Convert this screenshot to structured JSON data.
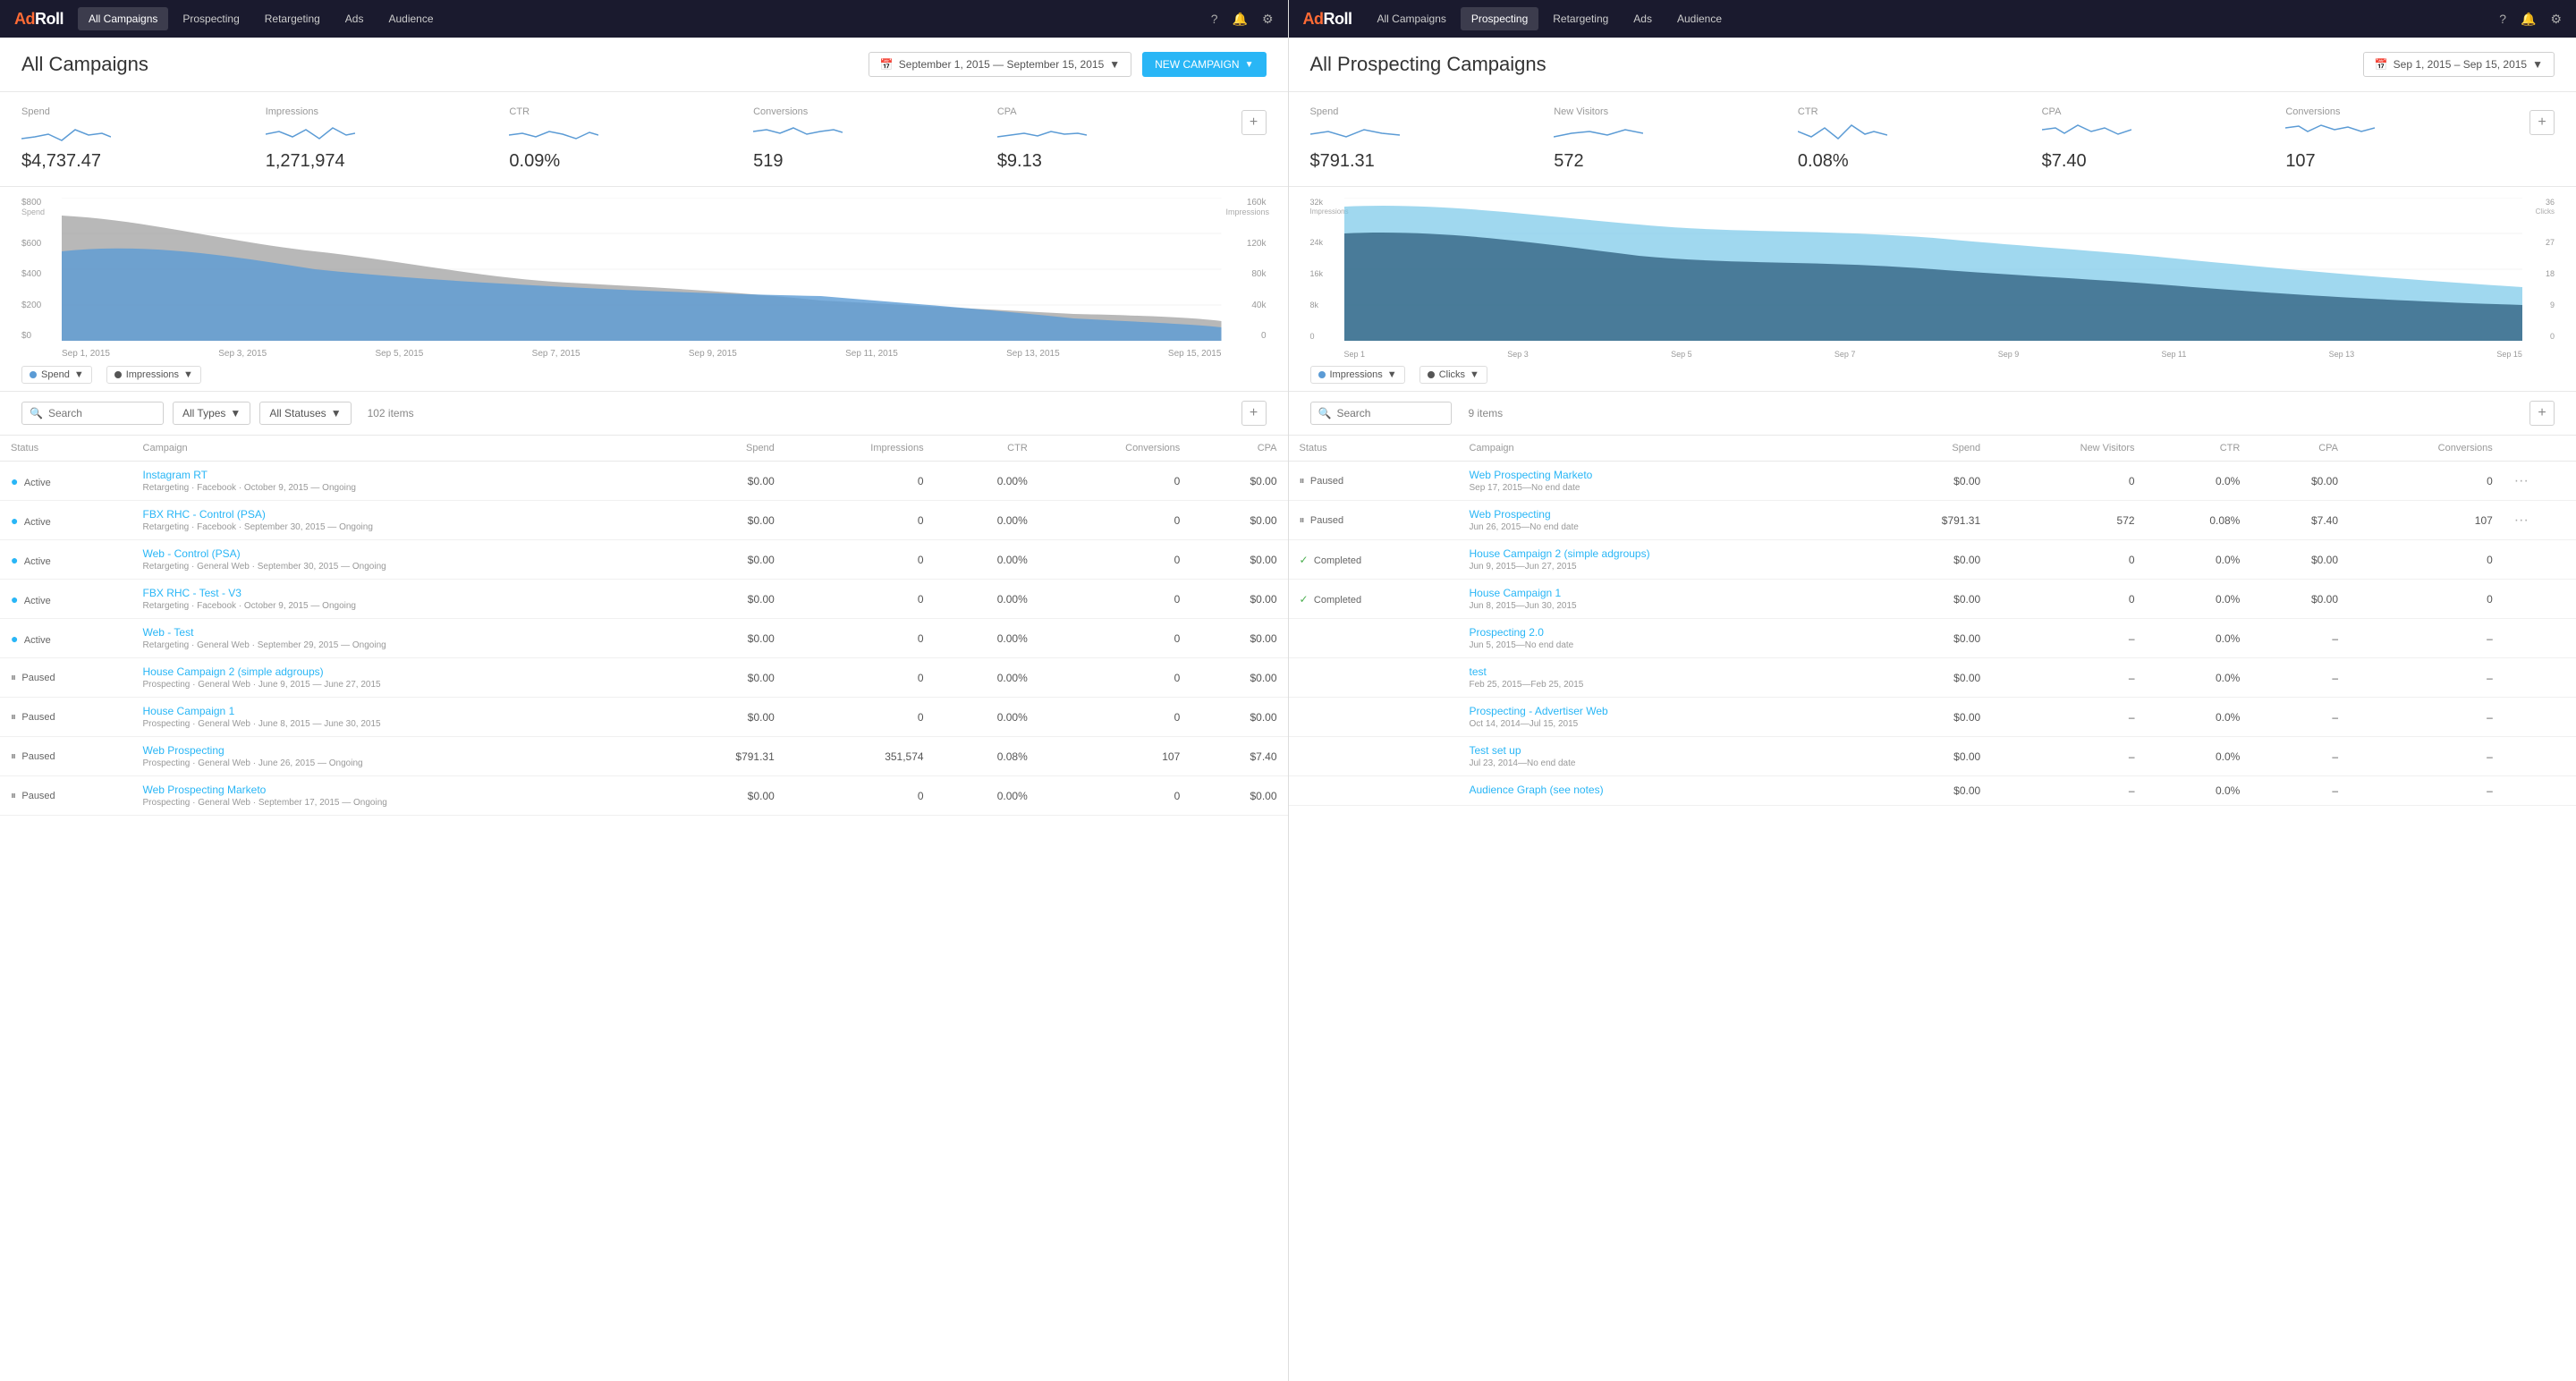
{
  "left_panel": {
    "nav": {
      "logo": "AdRoll",
      "items": [
        "All Campaigns",
        "Prospecting",
        "Retargeting",
        "Ads",
        "Audience"
      ],
      "active": "All Campaigns"
    },
    "title": "All Campaigns",
    "date_range": "September 1, 2015 — September 15, 2015",
    "new_campaign_label": "NEW CAMPAIGN",
    "metrics": [
      {
        "label": "Spend",
        "value": "$4,737.47"
      },
      {
        "label": "Impressions",
        "value": "1,271,974"
      },
      {
        "label": "CTR",
        "value": "0.09%"
      },
      {
        "label": "Conversions",
        "value": "519"
      },
      {
        "label": "CPA",
        "value": "$9.13"
      }
    ],
    "chart": {
      "y_left_label": "Spend",
      "y_right_label": "Impressions",
      "y_left": [
        "$800",
        "$600",
        "$400",
        "$200",
        "$0"
      ],
      "y_right": [
        "160k",
        "120k",
        "80k",
        "40k",
        "0"
      ],
      "x_axis": [
        "Sep 1, 2015",
        "Sep 3, 2015",
        "Sep 5, 2015",
        "Sep 7, 2015",
        "Sep 9, 2015",
        "Sep 11, 2015",
        "Sep 13, 2015",
        "Sep 15, 2015"
      ],
      "legend": [
        {
          "label": "Spend",
          "color": "#5b9bd5"
        },
        {
          "label": "Impressions",
          "color": "#555"
        }
      ]
    },
    "filter": {
      "search_placeholder": "Search",
      "type_label": "All Types",
      "status_label": "All Statuses",
      "items_count": "102 items"
    },
    "table": {
      "columns": [
        "Status",
        "Campaign",
        "Spend",
        "Impressions",
        "CTR",
        "Conversions",
        "CPA"
      ],
      "rows": [
        {
          "status": "Active",
          "status_type": "active",
          "name": "Instagram RT",
          "sub": "Retargeting · Facebook · October 9, 2015 — Ongoing",
          "spend": "$0.00",
          "impressions": "0",
          "ctr": "0.00%",
          "conversions": "0",
          "cpa": "$0.00"
        },
        {
          "status": "Active",
          "status_type": "active",
          "name": "FBX RHC - Control (PSA)",
          "sub": "Retargeting · Facebook · September 30, 2015 — Ongoing",
          "spend": "$0.00",
          "impressions": "0",
          "ctr": "0.00%",
          "conversions": "0",
          "cpa": "$0.00"
        },
        {
          "status": "Active",
          "status_type": "active",
          "name": "Web - Control (PSA)",
          "sub": "Retargeting · General Web · September 30, 2015 — Ongoing",
          "spend": "$0.00",
          "impressions": "0",
          "ctr": "0.00%",
          "conversions": "0",
          "cpa": "$0.00"
        },
        {
          "status": "Active",
          "status_type": "active",
          "name": "FBX RHC - Test - V3",
          "sub": "Retargeting · Facebook · October 9, 2015 — Ongoing",
          "spend": "$0.00",
          "impressions": "0",
          "ctr": "0.00%",
          "conversions": "0",
          "cpa": "$0.00"
        },
        {
          "status": "Active",
          "status_type": "active",
          "name": "Web - Test",
          "sub": "Retargeting · General Web · September 29, 2015 — Ongoing",
          "spend": "$0.00",
          "impressions": "0",
          "ctr": "0.00%",
          "conversions": "0",
          "cpa": "$0.00"
        },
        {
          "status": "Paused",
          "status_type": "paused",
          "name": "House Campaign 2 (simple adgroups)",
          "sub": "Prospecting · General Web · June 9, 2015 — June 27, 2015",
          "spend": "$0.00",
          "impressions": "0",
          "ctr": "0.00%",
          "conversions": "0",
          "cpa": "$0.00"
        },
        {
          "status": "Paused",
          "status_type": "paused",
          "name": "House Campaign 1",
          "sub": "Prospecting · General Web · June 8, 2015 — June 30, 2015",
          "spend": "$0.00",
          "impressions": "0",
          "ctr": "0.00%",
          "conversions": "0",
          "cpa": "$0.00"
        },
        {
          "status": "Paused",
          "status_type": "paused",
          "name": "Web Prospecting",
          "sub": "Prospecting · General Web · June 26, 2015 — Ongoing",
          "spend": "$791.31",
          "impressions": "351,574",
          "ctr": "0.08%",
          "conversions": "107",
          "cpa": "$7.40"
        },
        {
          "status": "Paused",
          "status_type": "paused",
          "name": "Web Prospecting Marketo",
          "sub": "Prospecting · General Web · September 17, 2015 — Ongoing",
          "spend": "$0.00",
          "impressions": "0",
          "ctr": "0.00%",
          "conversions": "0",
          "cpa": "$0.00"
        }
      ]
    }
  },
  "right_panel": {
    "nav": {
      "logo": "AdRoll",
      "items": [
        "All Campaigns",
        "Prospecting",
        "Retargeting",
        "Ads",
        "Audience"
      ],
      "active": "Prospecting"
    },
    "title": "All Prospecting Campaigns",
    "date_range": "Sep 1, 2015 – Sep 15, 2015",
    "metrics": [
      {
        "label": "Spend",
        "value": "$791.31"
      },
      {
        "label": "New Visitors",
        "value": "572"
      },
      {
        "label": "CTR",
        "value": "0.08%"
      },
      {
        "label": "CPA",
        "value": "$7.40"
      },
      {
        "label": "Conversions",
        "value": "107"
      }
    ],
    "chart": {
      "y_left": [
        "32k",
        "24k",
        "16k",
        "8k",
        "0"
      ],
      "y_left_label": "Impressions",
      "y_right": [
        "36",
        "27",
        "18",
        "9",
        "0"
      ],
      "y_right_label": "Clicks",
      "x_axis": [
        "Sep 1",
        "Sep 3",
        "Sep 5",
        "Sep 7",
        "Sep 9",
        "Sep 11",
        "Sep 13",
        "Sep 15"
      ],
      "legend": [
        {
          "label": "Impressions",
          "color": "#5b9bd5"
        },
        {
          "label": "Clicks",
          "color": "#555"
        }
      ]
    },
    "filter": {
      "search_placeholder": "Search",
      "items_count": "9 items"
    },
    "table": {
      "columns": [
        "Status",
        "Campaign",
        "Spend",
        "New Visitors",
        "CTR",
        "CPA",
        "Conversions"
      ],
      "rows": [
        {
          "status": "Paused",
          "status_type": "paused",
          "name": "Web Prospecting Marketo",
          "sub": "Sep 17, 2015—No end date",
          "spend": "$0.00",
          "new_visitors": "0",
          "ctr": "0.0%",
          "cpa": "$0.00",
          "conversions": "0",
          "has_more": true
        },
        {
          "status": "Paused",
          "status_type": "paused",
          "name": "Web Prospecting",
          "sub": "Jun 26, 2015—No end date",
          "spend": "$791.31",
          "new_visitors": "572",
          "ctr": "0.08%",
          "cpa": "$7.40",
          "conversions": "107",
          "has_more": true
        },
        {
          "status": "Completed",
          "status_type": "completed",
          "name": "House Campaign 2 (simple adgroups)",
          "sub": "Jun 9, 2015—Jun 27, 2015",
          "spend": "$0.00",
          "new_visitors": "0",
          "ctr": "0.0%",
          "cpa": "$0.00",
          "conversions": "0",
          "has_more": false
        },
        {
          "status": "Completed",
          "status_type": "completed",
          "name": "House Campaign 1",
          "sub": "Jun 8, 2015—Jun 30, 2015",
          "spend": "$0.00",
          "new_visitors": "0",
          "ctr": "0.0%",
          "cpa": "$0.00",
          "conversions": "0",
          "has_more": false
        },
        {
          "status": "",
          "status_type": "none",
          "name": "Prospecting 2.0",
          "sub": "Jun 5, 2015—No end date",
          "spend": "$0.00",
          "new_visitors": "–",
          "ctr": "0.0%",
          "cpa": "–",
          "conversions": "–",
          "has_more": false
        },
        {
          "status": "",
          "status_type": "none",
          "name": "test",
          "sub": "Feb 25, 2015—Feb 25, 2015",
          "spend": "$0.00",
          "new_visitors": "–",
          "ctr": "0.0%",
          "cpa": "–",
          "conversions": "–",
          "has_more": false
        },
        {
          "status": "",
          "status_type": "none",
          "name": "Prospecting - Advertiser Web",
          "sub": "Oct 14, 2014—Jul 15, 2015",
          "spend": "$0.00",
          "new_visitors": "–",
          "ctr": "0.0%",
          "cpa": "–",
          "conversions": "–",
          "has_more": false
        },
        {
          "status": "",
          "status_type": "none",
          "name": "Test set up",
          "sub": "Jul 23, 2014—No end date",
          "spend": "$0.00",
          "new_visitors": "–",
          "ctr": "0.0%",
          "cpa": "–",
          "conversions": "–",
          "has_more": false
        },
        {
          "status": "",
          "status_type": "none",
          "name": "Audience Graph (see notes)",
          "sub": "",
          "spend": "$0.00",
          "new_visitors": "–",
          "ctr": "0.0%",
          "cpa": "–",
          "conversions": "–",
          "has_more": false
        }
      ]
    }
  }
}
